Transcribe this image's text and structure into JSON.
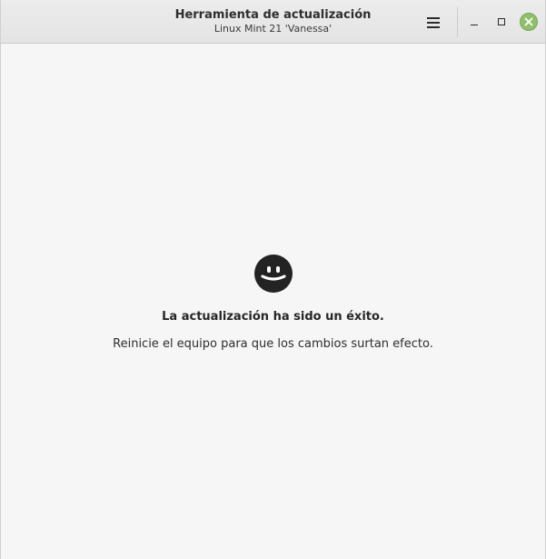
{
  "window": {
    "title": "Herramienta de actualización",
    "subtitle": "Linux Mint 21 'Vanessa'"
  },
  "titlebar_icons": {
    "menu": "hamburger-menu-icon",
    "minimize": "minimize-icon",
    "maximize": "maximize-icon",
    "close": "close-icon"
  },
  "main": {
    "status_icon": "smiley-face-icon",
    "status_title": "La actualización ha sido un éxito.",
    "status_message": "Reinicie el equipo para que los cambios surtan efecto."
  },
  "colors": {
    "close_button": "#8fbf6a",
    "background": "#f6f6f6"
  }
}
